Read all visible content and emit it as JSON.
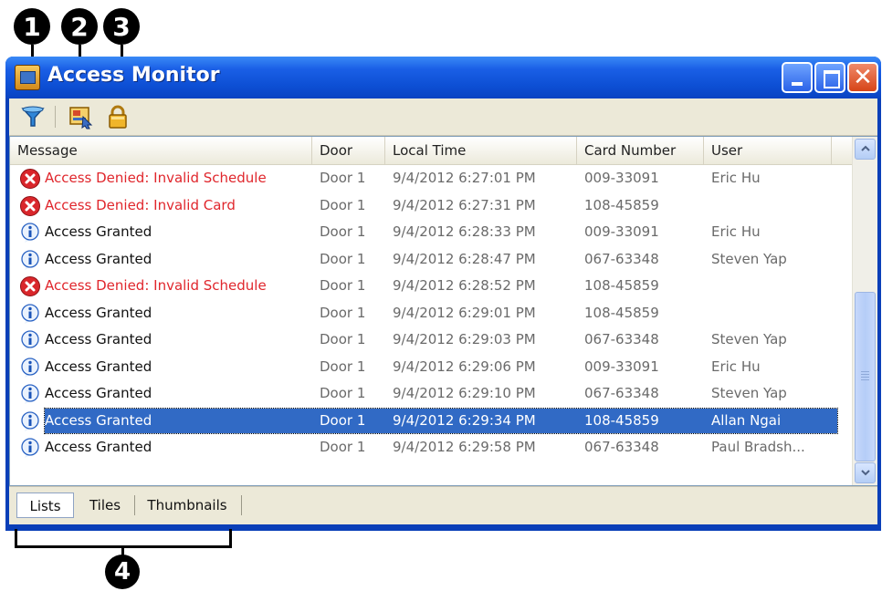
{
  "callouts": [
    "1",
    "2",
    "3",
    "4"
  ],
  "window": {
    "title": "Access Monitor",
    "buttons": [
      "minimize",
      "maximize",
      "close"
    ]
  },
  "toolbar": {
    "buttons": [
      {
        "icon": "filter-icon"
      },
      {
        "icon": "card-view-icon"
      },
      {
        "icon": "lock-icon"
      }
    ]
  },
  "columns": [
    "Message",
    "Door",
    "Local Time",
    "Card Number",
    "User"
  ],
  "rows": [
    {
      "status": "denied",
      "message": "Access Denied: Invalid Schedule",
      "door": "Door 1",
      "time": "9/4/2012 6:27:01 PM",
      "card": "009-33091",
      "user": "Eric Hu"
    },
    {
      "status": "denied",
      "message": "Access Denied: Invalid Card",
      "door": "Door 1",
      "time": "9/4/2012 6:27:31 PM",
      "card": "108-45859",
      "user": ""
    },
    {
      "status": "granted",
      "message": "Access Granted",
      "door": "Door 1",
      "time": "9/4/2012 6:28:33 PM",
      "card": "009-33091",
      "user": "Eric Hu"
    },
    {
      "status": "granted",
      "message": "Access Granted",
      "door": "Door 1",
      "time": "9/4/2012 6:28:47 PM",
      "card": "067-63348",
      "user": "Steven Yap"
    },
    {
      "status": "denied",
      "message": "Access Denied: Invalid Schedule",
      "door": "Door 1",
      "time": "9/4/2012 6:28:52 PM",
      "card": "108-45859",
      "user": ""
    },
    {
      "status": "granted",
      "message": "Access Granted",
      "door": "Door 1",
      "time": "9/4/2012 6:29:01 PM",
      "card": "108-45859",
      "user": ""
    },
    {
      "status": "granted",
      "message": "Access Granted",
      "door": "Door 1",
      "time": "9/4/2012 6:29:03 PM",
      "card": "067-63348",
      "user": "Steven Yap"
    },
    {
      "status": "granted",
      "message": "Access Granted",
      "door": "Door 1",
      "time": "9/4/2012 6:29:06 PM",
      "card": "009-33091",
      "user": "Eric Hu"
    },
    {
      "status": "granted",
      "message": "Access Granted",
      "door": "Door 1",
      "time": "9/4/2012 6:29:10 PM",
      "card": "067-63348",
      "user": "Steven Yap"
    },
    {
      "status": "granted",
      "message": "Access Granted",
      "door": "Door 1",
      "time": "9/4/2012 6:29:34 PM",
      "card": "108-45859",
      "user": "Allan Ngai",
      "selected": true
    },
    {
      "status": "granted",
      "message": "Access Granted",
      "door": "Door 1",
      "time": "9/4/2012 6:29:58 PM",
      "card": "067-63348",
      "user": "Paul Bradsh..."
    }
  ],
  "tabs": [
    "Lists",
    "Tiles",
    "Thumbnails"
  ],
  "active_tab": "Lists",
  "colors": {
    "denied_text": "#e0262c",
    "selection": "#316ac5",
    "titlebar": "#0d4fd4"
  }
}
